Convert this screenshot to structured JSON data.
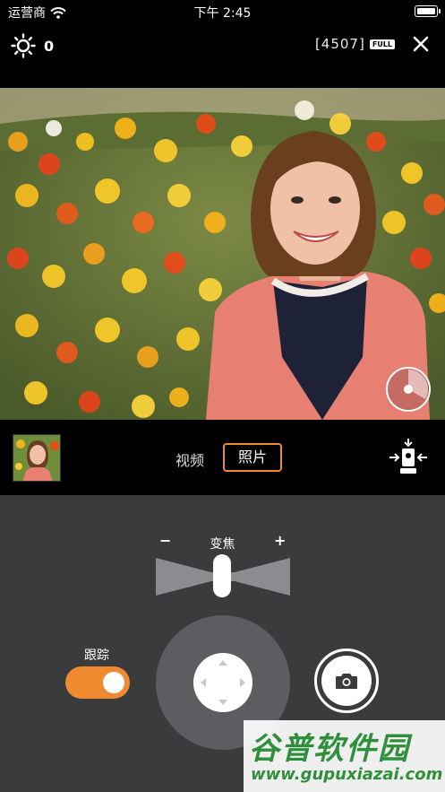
{
  "status_bar": {
    "carrier": "运营商",
    "time": "下午 2:45"
  },
  "top_bar": {
    "exposure_value": "0",
    "counter": "[4507]",
    "full_badge": "FULL"
  },
  "modes": {
    "video": "视频",
    "photo": "照片",
    "selected": "照片"
  },
  "zoom": {
    "label": "变焦",
    "minus": "−",
    "plus": "+"
  },
  "tracking": {
    "label": "跟踪",
    "enabled": true
  },
  "watermark": {
    "title": "谷普软件园",
    "url": "www.gupuxiazai.com"
  },
  "colors": {
    "accent": "#f08a30",
    "panel": "#3a3b3d",
    "joystick": "#5b5d61",
    "watermark": "#2f8f3a"
  },
  "icons": [
    "wifi-icon",
    "battery-icon",
    "brightness-icon",
    "close-icon",
    "balance-icon",
    "camera-icon",
    "arrow-up-icon",
    "arrow-down-icon",
    "arrow-left-icon",
    "arrow-right-icon"
  ]
}
